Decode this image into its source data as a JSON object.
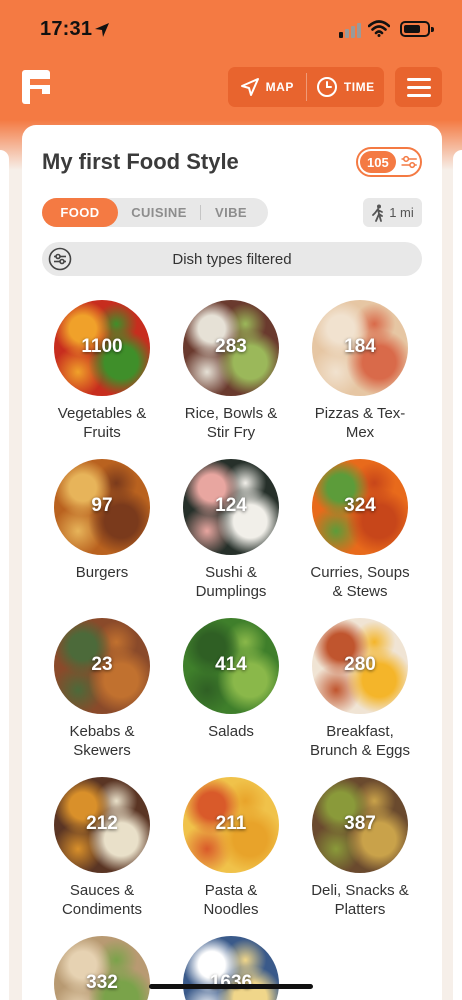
{
  "status_bar": {
    "time": "17:31",
    "icons": [
      "location-arrow-icon",
      "signal-icon",
      "wifi-icon",
      "battery-icon"
    ]
  },
  "header": {
    "logo_icon": "app-logo-icon",
    "map_label": "MAP",
    "time_label": "TIME",
    "menu_icon": "hamburger-menu-icon"
  },
  "card": {
    "title": "My first Food Style",
    "count": "105",
    "tabs": [
      {
        "label": "FOOD",
        "active": true
      },
      {
        "label": "CUISINE",
        "active": false
      },
      {
        "label": "VIBE",
        "active": false
      }
    ],
    "distance": "1 mi",
    "filter_text": "Dish types filtered"
  },
  "categories": [
    {
      "count": "1100",
      "label": "Vegetables &\nFruits",
      "colors": [
        "#c72d1e",
        "#3f8f2a",
        "#f0a12a"
      ]
    },
    {
      "count": "283",
      "label": "Rice, Bowls &\nStir Fry",
      "colors": [
        "#6a3a2e",
        "#9bb85a",
        "#e6e1d6"
      ]
    },
    {
      "count": "184",
      "label": "Pizzas & Tex-\nMex",
      "colors": [
        "#e6c6a3",
        "#d96a4a",
        "#f1e2cf"
      ]
    },
    {
      "count": "97",
      "label": "Burgers",
      "colors": [
        "#b9621f",
        "#7a3a1c",
        "#e7b45a"
      ]
    },
    {
      "count": "124",
      "label": "Sushi &\nDumplings",
      "colors": [
        "#26302a",
        "#f1efe9",
        "#e8a6a0"
      ]
    },
    {
      "count": "324",
      "label": "Curries, Soups\n& Stews",
      "colors": [
        "#e86a1b",
        "#c7461a",
        "#5c9c3a"
      ]
    },
    {
      "count": "23",
      "label": "Kebabs &\nSkewers",
      "colors": [
        "#8a4a2a",
        "#c1712f",
        "#4c6a3a"
      ]
    },
    {
      "count": "414",
      "label": "Salads",
      "colors": [
        "#3f7f2b",
        "#8ab84a",
        "#2f5f24"
      ]
    },
    {
      "count": "280",
      "label": "Breakfast,\nBrunch & Eggs",
      "colors": [
        "#f0e4d4",
        "#f4b52a",
        "#c0552e"
      ]
    },
    {
      "count": "212",
      "label": "Sauces &\nCondiments",
      "colors": [
        "#5a3524",
        "#e9e0c9",
        "#d9902a"
      ]
    },
    {
      "count": "211",
      "label": "Pasta &\nNoodles",
      "colors": [
        "#f0c24a",
        "#e8a32a",
        "#d95a2a"
      ]
    },
    {
      "count": "387",
      "label": "Deli, Snacks &\nPlatters",
      "colors": [
        "#6a4a2e",
        "#c9a24a",
        "#8a9a3a"
      ]
    },
    {
      "count": "332",
      "label": "",
      "colors": [
        "#b89a72",
        "#7aa34a",
        "#e6d2b2"
      ]
    },
    {
      "count": "1636",
      "label": "",
      "colors": [
        "#3a5a8a",
        "#f0d68a",
        "#ffffff"
      ]
    }
  ]
}
